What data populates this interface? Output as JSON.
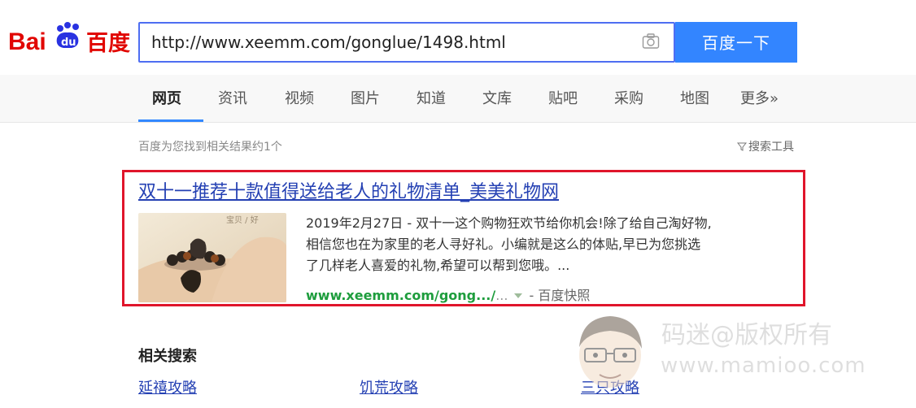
{
  "header": {
    "logo_text": "Bai百度",
    "search_value": "http://www.xeemm.com/gonglue/1498.html",
    "search_button": "百度一下"
  },
  "nav": {
    "items": [
      "网页",
      "资讯",
      "视频",
      "图片",
      "知道",
      "文库",
      "贴吧",
      "采购",
      "地图",
      "更多»"
    ],
    "active_index": 0
  },
  "results": {
    "count_text": "百度为您找到相关结果约1个",
    "tools_text": "搜索工具",
    "item": {
      "title": "双十一推荐十款值得送给老人的礼物清单_美美礼物网",
      "snippet_lines": [
        "2019年2月27日 - 双十一这个购物狂欢节给你机会!除了给自己淘好物,",
        "相信您也在为家里的老人寻好礼。小编就是这么的体贴,早已为您挑选",
        "了几样老人喜爱的礼物,希望可以帮到您哦。..."
      ],
      "url": "www.xeemm.com/gong.../",
      "url_ellipsis": "...",
      "cache": "- 百度快照",
      "thumb_caption": "宝贝 / 好"
    }
  },
  "related": {
    "title": "相关搜索",
    "items": [
      "延禧攻略",
      "饥荒攻略",
      "三只攻略"
    ]
  },
  "watermark": {
    "line1": "码迷@版权所有",
    "line2": "www.mamioo.com"
  },
  "colors": {
    "brand_blue": "#3385ff",
    "link_blue": "#2440b3",
    "url_green": "#1e9d3d",
    "highlight_red": "#e0152b"
  }
}
